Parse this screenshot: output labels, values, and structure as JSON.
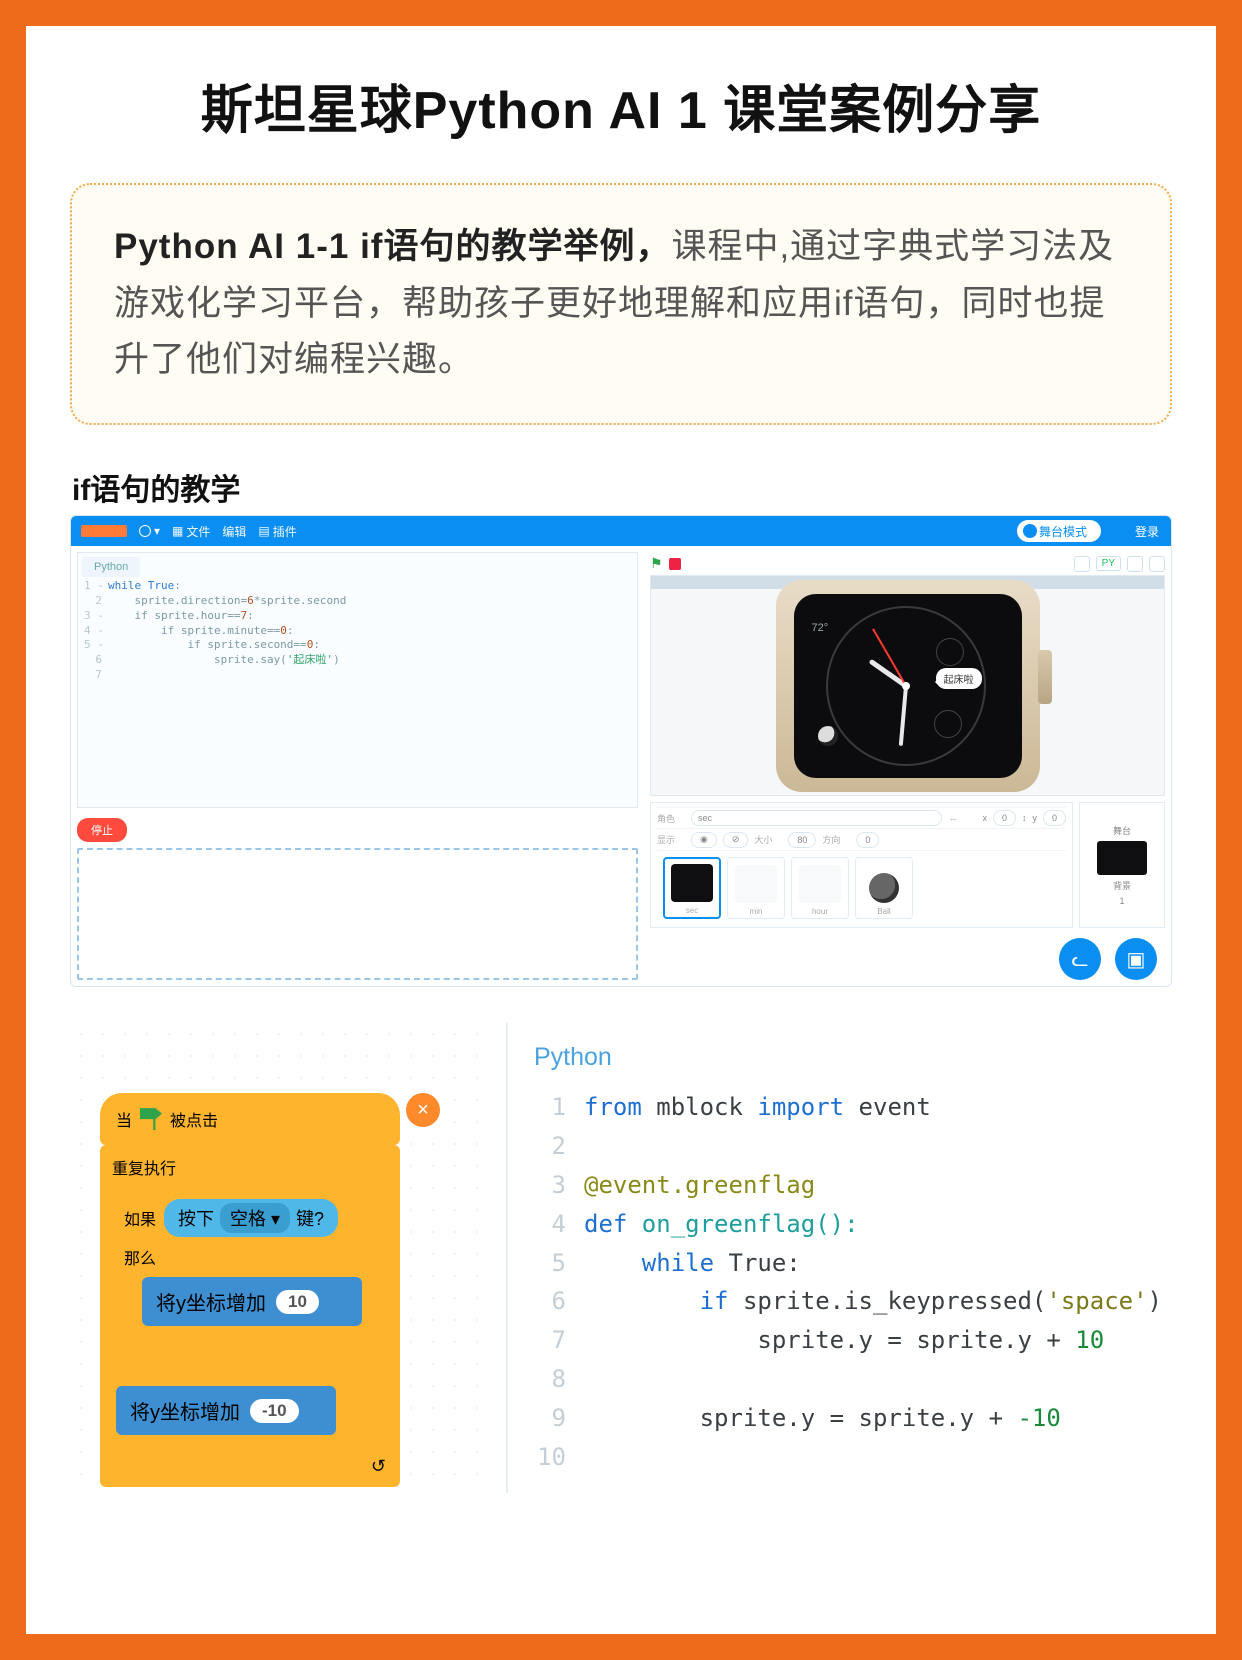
{
  "title": "斯坦星球Python AI 1 课堂案例分享",
  "intro": {
    "lead": "Python AI 1-1 if语句的教学举例，",
    "rest": "课程中,通过字典式学习法及游戏化学习平台，帮助孩子更好地理解和应用if语句，同时也提升了他们对编程兴趣。"
  },
  "sub_heading": "if语句的教学",
  "ide": {
    "top": {
      "file": "文件",
      "edit": "编辑",
      "plugin": "插件",
      "mode": "舞台模式",
      "menu": "登录",
      "py_btn": "PY"
    },
    "code_tab": "Python",
    "gutter": "1 -\n2\n3 -\n4 -\n5 -\n6\n7",
    "code_parts": {
      "l1a": "while ",
      "l1b": "True",
      "l1c": ":",
      "l2a": "    sprite.direction=",
      "l2b": "6",
      "l2c": "*sprite.second",
      "l3a": "    if sprite.hour==",
      "l3b": "7",
      "l3c": ":",
      "l4a": "        if sprite.minute==",
      "l4b": "0",
      "l4c": ":",
      "l5a": "            if sprite.second==",
      "l5b": "0",
      "l5c": ":",
      "l6a": "                sprite.say(",
      "l6b": "'起床啦'",
      "l6c": ")",
      "l7": ""
    },
    "stop": "停止",
    "watch": {
      "temp": "72°",
      "bubble": "起床啦"
    },
    "sprite_panel": {
      "label_sprite": "角色",
      "name": "sec",
      "arrows": "↔",
      "x_label": "x",
      "x_val": "0",
      "y_label": "y",
      "y_val": "0",
      "show": "显示",
      "size_l": "大小",
      "size_v": "80",
      "dir_l": "方向",
      "dir_v": "0",
      "stage": "舞台",
      "bg": "背景",
      "bg_n": "1"
    },
    "thumbs": {
      "t1": "sec",
      "t2": "min",
      "t3": "hour",
      "t4": "Ball"
    }
  },
  "blocks": {
    "close": "×",
    "hat": "当      被点击",
    "hat_word": "被点击",
    "hat_pre": "当",
    "loop": "重复执行",
    "if_pre": "如果",
    "if_post": "那么",
    "cond_pre": "按下",
    "cond_opt": "空格 ▾",
    "cond_post": "键?",
    "m1_text": "将y坐标增加",
    "m1_val": "10",
    "m2_text": "将y坐标增加",
    "m2_val": "-10",
    "j": "↺"
  },
  "python": {
    "tab": "Python",
    "gutter": "1\n2\n3\n4\n5\n6\n7\n8\n9\n10",
    "lines": {
      "l1a": "from",
      "l1b": " mblock ",
      "l1c": "import",
      "l1d": " event",
      "l3": "@event.greenflag",
      "l4a": "def",
      "l4b": " on_greenflag():",
      "l5a": "    while",
      "l5b": " True:",
      "l6a": "        if",
      "l6b": " sprite.is_keypressed(",
      "l6c": "'space'",
      "l6d": ")",
      "l7a": "            sprite.y = sprite.y + ",
      "l7b": "10",
      "l9a": "        sprite.y = sprite.y + ",
      "l9b": "-10"
    }
  }
}
